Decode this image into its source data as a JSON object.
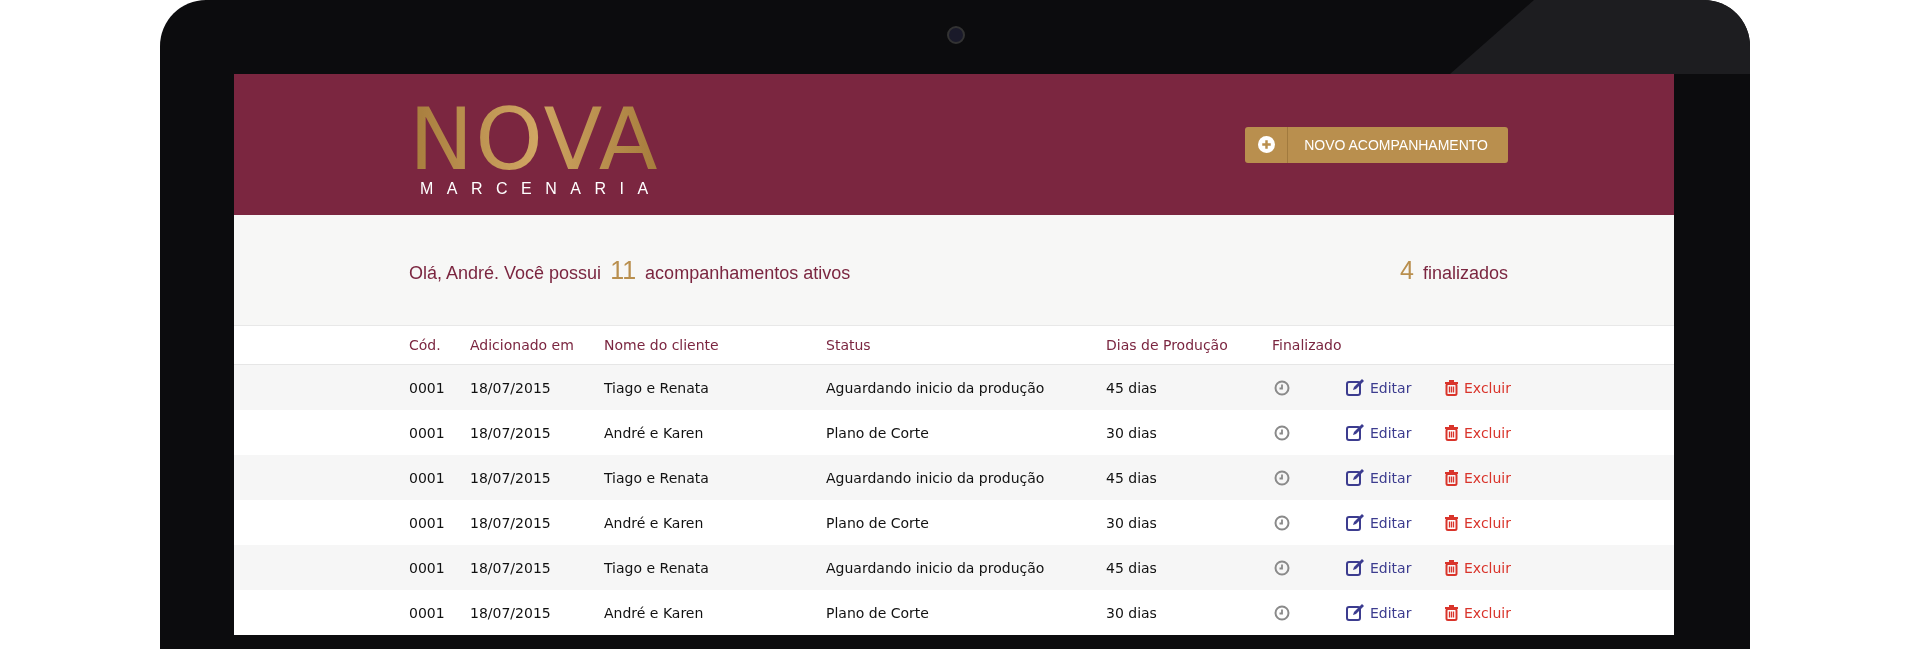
{
  "header": {
    "logo": {
      "title": "NOVA",
      "subtitle": "MARCENARIA"
    },
    "new_button": {
      "label": "NOVO ACOMPANHAMENTO"
    }
  },
  "summary": {
    "greeting_before": "Olá, André. Você possui",
    "active_count": "11",
    "greeting_after": "acompanhamentos ativos",
    "finished_count": "4",
    "finished_label": "finalizados"
  },
  "table": {
    "columns": [
      "Cód.",
      "Adicionado em",
      "Nome do cliente",
      "Status",
      "Dias de Produção",
      "Finalizado"
    ],
    "rows": [
      {
        "code": "0001",
        "added": "18/07/2015",
        "client": "Tiago e Renata",
        "status": "Aguardando inicio da produção",
        "days": "45 dias",
        "finalizado": false,
        "edit": "Editar",
        "delete": "Excluir"
      },
      {
        "code": "0001",
        "added": "18/07/2015",
        "client": "André e Karen",
        "status": "Plano de Corte",
        "days": "30 dias",
        "finalizado": false,
        "edit": "Editar",
        "delete": "Excluir"
      },
      {
        "code": "0001",
        "added": "18/07/2015",
        "client": "Tiago e Renata",
        "status": "Aguardando inicio da produção",
        "days": "45 dias",
        "finalizado": false,
        "edit": "Editar",
        "delete": "Excluir"
      },
      {
        "code": "0001",
        "added": "18/07/2015",
        "client": "André e Karen",
        "status": "Plano de Corte",
        "days": "30 dias",
        "finalizado": false,
        "edit": "Editar",
        "delete": "Excluir"
      },
      {
        "code": "0001",
        "added": "18/07/2015",
        "client": "Tiago e Renata",
        "status": "Aguardando inicio da produção",
        "days": "45 dias",
        "finalizado": false,
        "edit": "Editar",
        "delete": "Excluir"
      },
      {
        "code": "0001",
        "added": "18/07/2015",
        "client": "André e Karen",
        "status": "Plano de Corte",
        "days": "30 dias",
        "finalizado": false,
        "edit": "Editar",
        "delete": "Excluir"
      }
    ]
  }
}
